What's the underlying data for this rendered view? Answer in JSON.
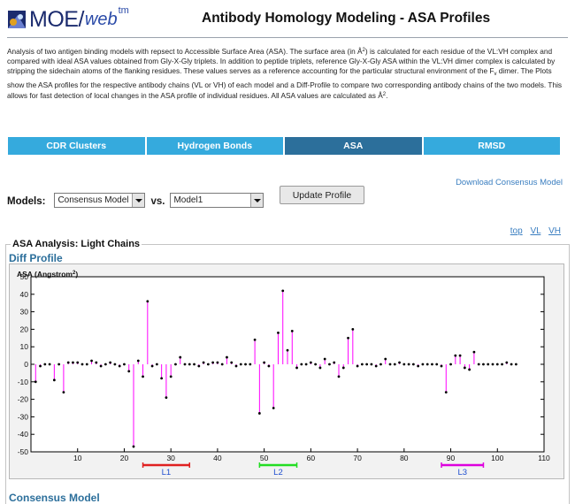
{
  "header": {
    "logo_text": "MOE/",
    "logo_web": "web",
    "logo_tm": "tm",
    "page_title": "Antibody Homology Modeling - ASA Profiles"
  },
  "intro": {
    "p1": "Analysis of two antigen binding models with repsect to Accessible Surface Area (ASA). The surface area (in Å",
    "p1_sup": "2",
    "p2": ") is calculated for each residue of the VL:VH complex and compared with ideal ASA values obtained from Gly-X-Gly triplets. In addition to peptide triplets, reference Gly-X-Gly ASA within the VL:VH dimer complex is calculated by stripping the sidechain atoms of the flanking residues. These values serves as a reference accounting for the particular structural environment of the F",
    "p2_sub": "v",
    "p3": " dimer. The Plots show the ASA profiles for the respective antibody chains (VL or VH) of each model and a Diff-Profile to compare two corresponding antibody chains of the two models. This allows for fast detection of local changes in the ASA profile of individual residues. All ASA values are calculated as Å",
    "p3_sup": "2",
    "p3_end": "."
  },
  "tabs": [
    {
      "label": "CDR Clusters",
      "active": false
    },
    {
      "label": "Hydrogen Bonds",
      "active": false
    },
    {
      "label": "ASA",
      "active": true
    },
    {
      "label": "RMSD",
      "active": false
    }
  ],
  "download_link": "Download Consensus Model",
  "models": {
    "label": "Models:",
    "model_a": "Consensus Model",
    "vs": "vs.",
    "model_b": "Model1",
    "update_button": "Update Profile"
  },
  "nav_links": {
    "top": "top",
    "vl": "VL",
    "vh": "VH"
  },
  "section": {
    "legend": "ASA Analysis: Light Chains",
    "diff_title": "Diff Profile",
    "ylabel": "ASA (Angstrom",
    "ylabel_sup": "2",
    "ylabel_end": ")",
    "consensus_title": "Consensus Model"
  },
  "colors": {
    "tab": "#35aadd",
    "tab_active": "#2c6f9b",
    "stem": "#ff00ff",
    "l1": "#e02020",
    "l2": "#22dd22",
    "l3": "#dd00dd",
    "link": "#3a7ec0"
  },
  "chart_data": {
    "type": "scatter",
    "title": "Diff Profile",
    "ylabel": "ASA (Angstrom²)",
    "xlim": [
      0,
      110
    ],
    "ylim": [
      -50,
      50
    ],
    "xticks": [
      10,
      20,
      30,
      40,
      50,
      60,
      70,
      80,
      90,
      100,
      110
    ],
    "yticks": [
      -50,
      -40,
      -30,
      -20,
      -10,
      0,
      10,
      20,
      30,
      40,
      50
    ],
    "x_start": 1,
    "values": [
      -10,
      -1,
      0,
      0,
      -9,
      0,
      -16,
      1,
      1,
      1,
      0,
      0,
      2,
      1,
      -1,
      0,
      1,
      0,
      -1,
      0,
      -4,
      -47,
      2,
      -7,
      36,
      -1,
      0,
      -8,
      -19,
      -7,
      0,
      4,
      0,
      0,
      0,
      -1,
      1,
      0,
      1,
      1,
      0,
      4,
      1,
      -1,
      0,
      0,
      0,
      14,
      -28,
      1,
      -1,
      -25,
      18,
      42,
      8,
      19,
      -2,
      0,
      0,
      1,
      0,
      -2,
      3,
      0,
      1,
      -7,
      -2,
      15,
      20,
      -1,
      0,
      0,
      0,
      -1,
      0,
      3,
      0,
      0,
      1,
      0,
      0,
      0,
      -1,
      0,
      0,
      0,
      0,
      -1,
      -16,
      0,
      5,
      5,
      -2,
      -3,
      7,
      0,
      0,
      0,
      0,
      0,
      0,
      1,
      0,
      0
    ],
    "regions": [
      {
        "label": "L1",
        "start": 24,
        "end": 34
      },
      {
        "label": "L2",
        "start": 49,
        "end": 57
      },
      {
        "label": "L3",
        "start": 88,
        "end": 97
      }
    ]
  }
}
